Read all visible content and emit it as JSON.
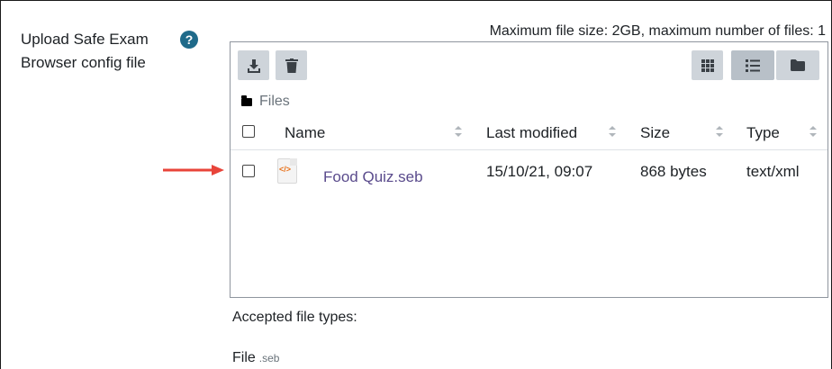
{
  "field": {
    "label_line1": "Upload Safe Exam",
    "label_line2": "Browser config file",
    "help_symbol": "?"
  },
  "limits": {
    "text": "Maximum file size: 2GB, maximum number of files: 1"
  },
  "toolbar": {
    "left_icons": [
      "download-icon",
      "trash-icon"
    ],
    "view_icons": [
      "grid-view-icon",
      "list-view-icon",
      "folder-view-icon"
    ],
    "active_view": "list-view-icon"
  },
  "breadcrumb": {
    "label": "Files"
  },
  "table": {
    "columns": [
      "Name",
      "Last modified",
      "Size",
      "Type"
    ],
    "rows": [
      {
        "name": "Food Quiz.seb",
        "modified": "15/10/21, 09:07",
        "size": "868 bytes",
        "type": "text/xml",
        "icon_text": "</>"
      }
    ]
  },
  "accepted": {
    "heading": "Accepted file types:",
    "type_label": "File",
    "type_ext": ".seb"
  },
  "colors": {
    "annotation_arrow": "#e8443a",
    "file_link": "#5a4b8c",
    "help_icon": "#1f6a8a"
  }
}
